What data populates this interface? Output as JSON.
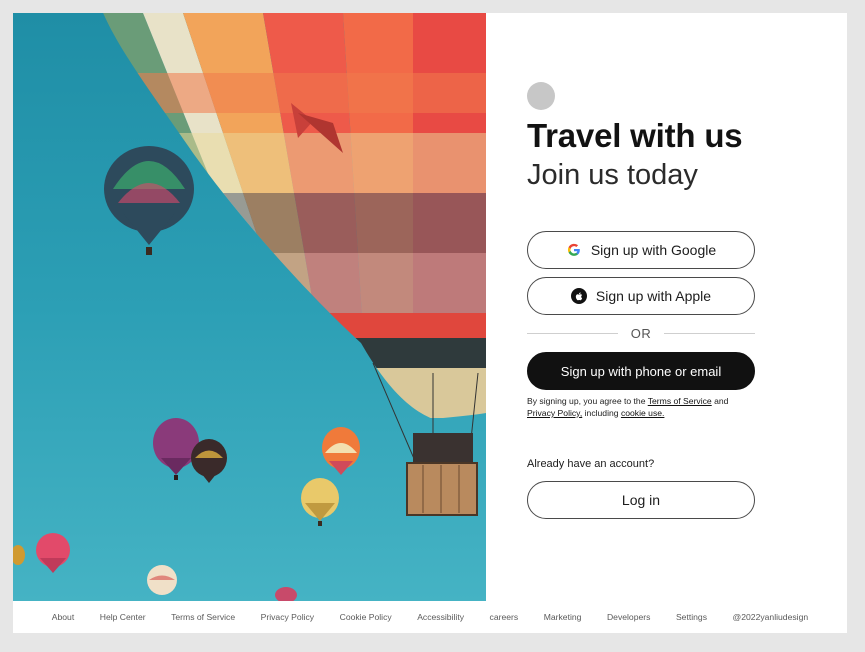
{
  "header": {
    "title": "Travel with us",
    "subtitle": "Join us today"
  },
  "auth": {
    "google_label": "Sign up with Google",
    "apple_label": "Sign up with Apple",
    "divider_label": "OR",
    "phone_email_label": "Sign up with phone or email",
    "legal": {
      "prefix": "By signing up, you agree to the",
      "terms_link": "Terms of Service",
      "and": "and",
      "privacy_link": "Privacy Policy,",
      "including": "including",
      "cookie_link": "cookie use."
    },
    "already_label": "Already have an account?",
    "login_label": "Log in"
  },
  "footer": {
    "links": [
      "About",
      "Help Center",
      "Terms of Service",
      "Privacy Policy",
      "Cookie Policy",
      "Accessibility",
      "careers",
      "Marketing",
      "Developers",
      "Settings",
      "@2022yanliudesign"
    ]
  },
  "hero": {
    "image": "hot-air-balloons-photo",
    "sky_color": "#2c9fb5"
  },
  "colors": {
    "primary_button": "#111111",
    "logo_placeholder": "#c7c7c7",
    "page_background": "#e6e6e6"
  }
}
